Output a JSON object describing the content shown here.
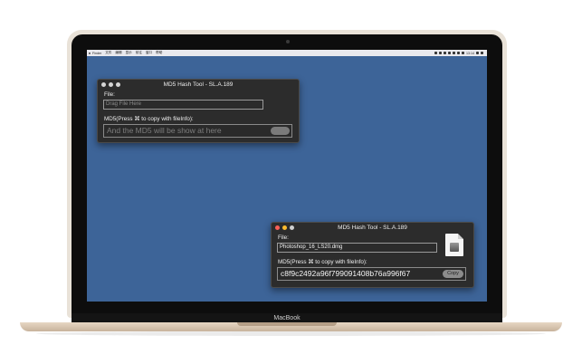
{
  "device": {
    "brand_label": "MacBook"
  },
  "menubar": {
    "apple": "",
    "items": [
      "Finder",
      "文件",
      "编辑",
      "显示",
      "前往",
      "窗口",
      "帮助"
    ],
    "clock": "13:14"
  },
  "window_inactive": {
    "title": "MD5 Hash Tool - SL.A.189",
    "file_label": "File:",
    "file_placeholder": "Drag  File Here",
    "md5_label": "MD5(Press ⌘ to copy with fileInfo):",
    "md5_placeholder": "And the MD5 will be show at here",
    "copy_label": ""
  },
  "window_active": {
    "title": "MD5 Hash Tool - SL.A.189",
    "file_label": "File:",
    "file_value": "Photoshop_16_LS20.dmg",
    "md5_label": "MD5(Press ⌘ to copy with fileInfo):",
    "md5_value": "c8f9c2492a96f799091408b76a996f67",
    "copy_label": "Copy",
    "file_icon": "dmg-file-icon"
  },
  "colors": {
    "desktop": "#3d6498",
    "window_bg": "#2c2c2c",
    "close": "#fc5f57",
    "minimize": "#fdbc2e",
    "zoom": "#cfcfcf",
    "inactive_light": "#d5d5d5"
  }
}
